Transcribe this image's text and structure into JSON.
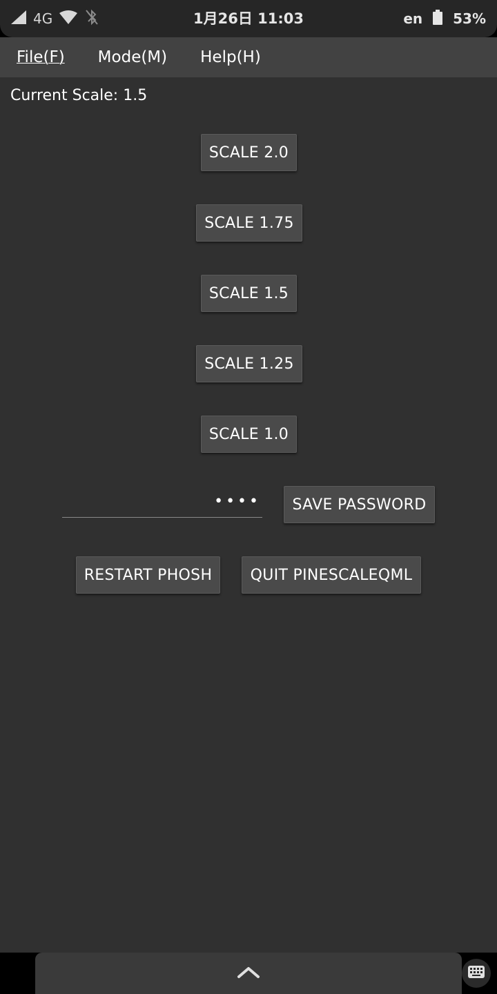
{
  "status_bar": {
    "network": "4G",
    "date_time": "1月26日  11:03",
    "language": "en",
    "battery": "53%",
    "icons": [
      "signal-icon",
      "wifi-icon",
      "bluetooth-off-icon",
      "battery-icon"
    ]
  },
  "menu": {
    "file": "File(F)",
    "mode": "Mode(M)",
    "help": "Help(H)"
  },
  "current_scale": "Current Scale: 1.5",
  "scale_buttons": [
    "SCALE 2.0",
    "SCALE 1.75",
    "SCALE 1.5",
    "SCALE 1.25",
    "SCALE 1.0"
  ],
  "password": {
    "value_masked": "••••"
  },
  "actions": {
    "save_password": "SAVE PASSWORD",
    "restart_phosh": "RESTART PHOSH",
    "quit": "QUIT PINESCALEQML"
  },
  "colors": {
    "background": "#303030",
    "menubar": "#424242",
    "button": "#4a4a4a"
  }
}
